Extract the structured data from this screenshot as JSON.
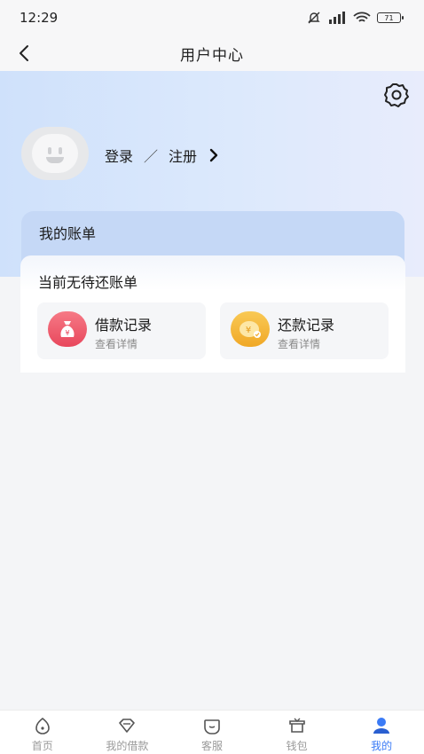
{
  "status_bar": {
    "time": "12:29",
    "battery": "71"
  },
  "nav": {
    "title": "用户中心"
  },
  "profile": {
    "login_label": "登录",
    "separator": "／",
    "register_label": "注册"
  },
  "bill": {
    "title": "我的账单",
    "status": "当前无待还账单",
    "records": [
      {
        "title": "借款记录",
        "subtitle": "查看详情",
        "icon": "money-bag-icon",
        "color": "#ef5b6e"
      },
      {
        "title": "还款记录",
        "subtitle": "查看详情",
        "icon": "yen-coin-icon",
        "color": "#f5b53a"
      }
    ]
  },
  "tabbar": {
    "items": [
      {
        "label": "首页",
        "icon": "home-icon"
      },
      {
        "label": "我的借款",
        "icon": "diamond-icon"
      },
      {
        "label": "客服",
        "icon": "chat-icon"
      },
      {
        "label": "钱包",
        "icon": "wallet-icon"
      },
      {
        "label": "我的",
        "icon": "user-icon",
        "active": true
      }
    ],
    "active_color": "#3b7bf6"
  }
}
